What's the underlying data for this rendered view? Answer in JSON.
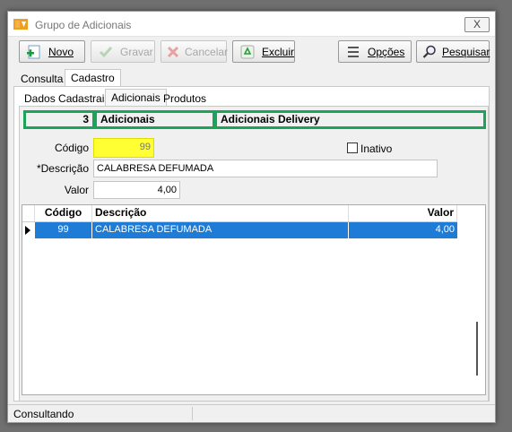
{
  "window": {
    "title": "Grupo de Adicionais",
    "close_label": "X"
  },
  "toolbar": {
    "novo": "Novo",
    "gravar": "Gravar",
    "cancelar": "Cancelar",
    "excluir": "Excluir",
    "opcoes": "Opções",
    "pesquisar": "Pesquisar"
  },
  "tabs": {
    "consulta": "Consulta",
    "cadastro": "Cadastro"
  },
  "subtabs": {
    "dados": "Dados Cadastrais",
    "adicionais": "Adicionais",
    "produtos": "Produtos"
  },
  "header": {
    "id": "3",
    "name": "Adicionais",
    "desc": "Adicionais Delivery"
  },
  "form": {
    "codigo_label": "Código",
    "codigo_value": "99",
    "inativo_label": "Inativo",
    "descricao_label": "*Descrição",
    "descricao_value": "CALABRESA DEFUMADA",
    "valor_label": "Valor",
    "valor_value": "4,00"
  },
  "grid": {
    "columns": [
      "Código",
      "Descrição",
      "Valor"
    ],
    "rows": [
      {
        "codigo": "99",
        "descricao": "CALABRESA DEFUMADA",
        "valor": "4,00"
      }
    ]
  },
  "status": {
    "text": "Consultando"
  },
  "colors": {
    "highlight": "#1aa45a",
    "selection": "#1e7bd6",
    "code_field": "#ffff33"
  }
}
